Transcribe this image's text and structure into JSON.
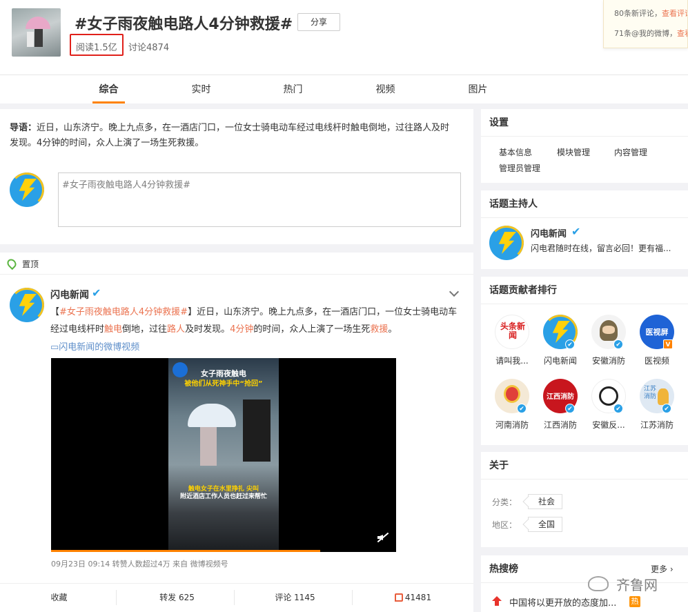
{
  "header": {
    "title": "#女子雨夜触电路人4分钟救援#",
    "share_label": "分享",
    "read_count": "阅读1.5亿",
    "discussion_count": "讨论4874",
    "notifications": {
      "new_comments": "80条新评论，",
      "view_comments": "查看评论",
      "mentions": "71条@我的微博，",
      "view_mentions": "查看@我"
    }
  },
  "tabs": [
    {
      "label": "综合",
      "active": true
    },
    {
      "label": "实时"
    },
    {
      "label": "热门"
    },
    {
      "label": "视频"
    },
    {
      "label": "图片"
    }
  ],
  "intro": {
    "prefix": "导语：",
    "text": "近日，山东济宁。晚上九点多，在一酒店门口，一位女士骑电动车经过电线杆时触电倒地，过往路人及时发现。4分钟的时间，众人上演了一场生死救援。"
  },
  "compose": {
    "placeholder": "#女子雨夜触电路人4分钟救援#"
  },
  "feed": {
    "pinned_label": "置顶",
    "post": {
      "author": "闪电新闻",
      "text_parts": {
        "bracket_open": "【",
        "hashtag": "#女子雨夜触电路人4分钟救援#",
        "bracket_close": "】",
        "t1": "近日，山东济宁。晚上九点多，在一酒店门口，一位女士骑电动车经过电线杆时",
        "h1": "触电",
        "t2": "倒地，过往",
        "h2": "路人",
        "t3": "及时发现。",
        "h3": "4分钟",
        "t4": "的时间，众人上演了一场生死",
        "h4": "救援",
        "t5": "。"
      },
      "video_link": "闪电新闻的微博视频",
      "video_captions": {
        "title1": "女子雨夜触电",
        "title2": "被他们从死神手中“抢回”",
        "sub1": "触电女子在水里挣扎 尖叫",
        "sub2": "附近酒店工作人员也赶过来帮忙"
      },
      "video_progress": 0.78,
      "meta": "09月23日 09:14 转赞人数超过4万  来自 微博视频号",
      "actions": {
        "favorite": "收藏",
        "repost": "转发 625",
        "comment": "评论 1145",
        "like": "41481"
      }
    }
  },
  "sidebar": {
    "settings": {
      "title": "设置",
      "links": [
        "基本信息",
        "模块管理",
        "内容管理",
        "管理员管理"
      ]
    },
    "host": {
      "title": "话题主持人",
      "name": "闪电新闻",
      "desc": "闪电君随时在线，留言必回！更有福..."
    },
    "contributors": {
      "title": "话题贡献者排行",
      "items": [
        {
          "name": "请叫我...",
          "color": "#ffffff",
          "logo_text": "头条新闻"
        },
        {
          "name": "闪电新闻",
          "color": "#2aa0e6"
        },
        {
          "name": "安徽消防",
          "color": "#f3f3f3"
        },
        {
          "name": "医视频",
          "color": "#1e63d6",
          "logo_text": "医视屏"
        },
        {
          "name": "河南消防",
          "color": "#f4e9d6"
        },
        {
          "name": "江西消防",
          "color": "#c8161e",
          "logo_text": "江西消防"
        },
        {
          "name": "安徽反...",
          "color": "#ffffff"
        },
        {
          "name": "江苏消防",
          "color": "#dfe9f3",
          "logo_text": "江苏消防"
        }
      ]
    },
    "about": {
      "title": "关于",
      "category_label": "分类：",
      "category": "社会",
      "region_label": "地区：",
      "region": "全国"
    },
    "hot_search": {
      "title": "热搜榜",
      "more": "更多",
      "item": "中国将以更开放的态度加...",
      "badge": "热"
    }
  },
  "watermark": "齐鲁网"
}
